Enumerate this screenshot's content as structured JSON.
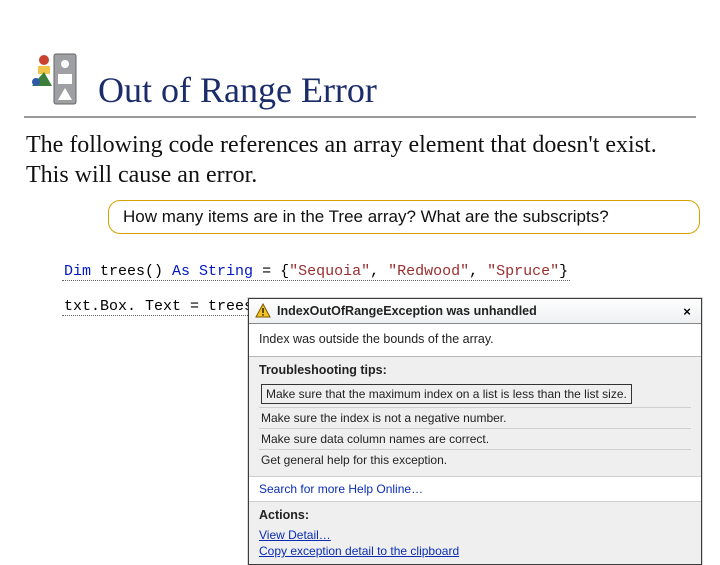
{
  "title": "Out of Range Error",
  "body": "The following code references an array element that doesn't exist.  This will cause an error.",
  "callout": "How many items are in the Tree array? What are the subscripts?",
  "code": {
    "line1_kw1": "Dim",
    "line1_ident": " trees() ",
    "line1_kw2": "As String",
    "line1_eq": " = {",
    "line1_s1": "\"Sequoia\"",
    "line1_c1": ", ",
    "line1_s2": "\"Redwood\"",
    "line1_c2": ", ",
    "line1_s3": "\"Spruce\"",
    "line1_end": "}",
    "line2": "txt.Box. Text = trees(5)"
  },
  "popup": {
    "title": "IndexOutOfRangeException was unhandled",
    "close": "×",
    "message": "Index was outside the bounds of the array.",
    "tips_label": "Troubleshooting tips:",
    "tips": [
      "Make sure that the maximum index on a list is less than the list size.",
      "Make sure the index is not a negative number.",
      "Make sure data column names are correct.",
      "Get general help for this exception."
    ],
    "search_link": "Search for more Help Online…",
    "actions_label": "Actions:",
    "action_view": "View Detail…",
    "action_copy": "Copy exception detail to the clipboard"
  }
}
